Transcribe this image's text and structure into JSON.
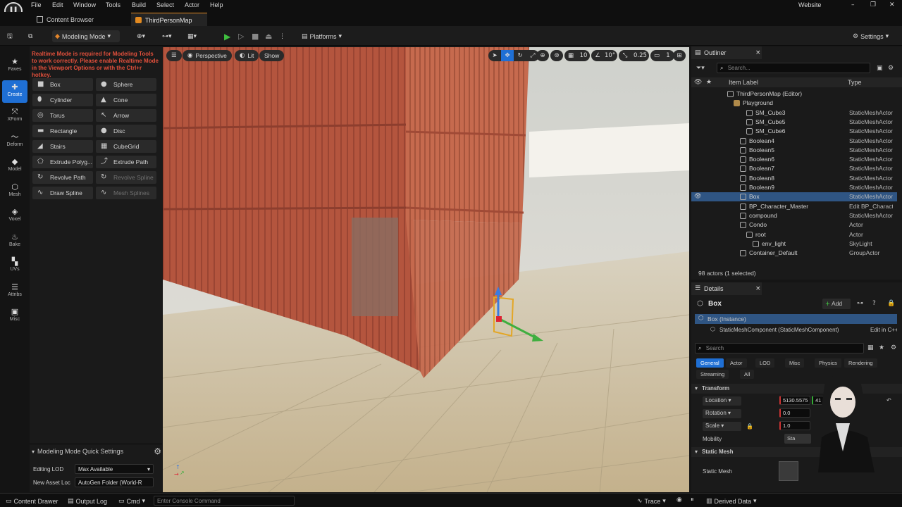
{
  "menu": {
    "items": [
      "File",
      "Edit",
      "Window",
      "Tools",
      "Build",
      "Select",
      "Actor",
      "Help"
    ],
    "right_label": "Website"
  },
  "tabs": [
    {
      "label": "Content Browser",
      "active": false
    },
    {
      "label": "ThirdPersonMap",
      "active": true
    }
  ],
  "toolbar": {
    "mode_label": "Modeling Mode",
    "platforms_label": "Platforms",
    "settings_label": "Settings"
  },
  "modes": [
    {
      "label": "Faves",
      "icon": "star-icon"
    },
    {
      "label": "Create",
      "icon": "create-icon",
      "selected": true
    },
    {
      "label": "XForm",
      "icon": "xform-icon"
    },
    {
      "label": "Deform",
      "icon": "deform-icon"
    },
    {
      "label": "Model",
      "icon": "model-icon"
    },
    {
      "label": "Mesh",
      "icon": "mesh-icon"
    },
    {
      "label": "Voxel",
      "icon": "voxel-icon"
    },
    {
      "label": "Bake",
      "icon": "bake-icon"
    },
    {
      "label": "UVs",
      "icon": "uvs-icon"
    },
    {
      "label": "Attribs",
      "icon": "attribs-icon"
    },
    {
      "label": "Misc",
      "icon": "misc-icon"
    }
  ],
  "tool_panel": {
    "warning": "Realtime Mode is required for Modeling Tools to work correctly. Please enable Realtime Mode in the Viewport Options or with the Ctrl+r hotkey.",
    "tools": [
      {
        "label": "Box",
        "icon": "box-icon"
      },
      {
        "label": "Sphere",
        "icon": "sphere-icon"
      },
      {
        "label": "Cylinder",
        "icon": "cylinder-icon"
      },
      {
        "label": "Cone",
        "icon": "cone-icon"
      },
      {
        "label": "Torus",
        "icon": "torus-icon"
      },
      {
        "label": "Arrow",
        "icon": "arrow-icon"
      },
      {
        "label": "Rectangle",
        "icon": "rectangle-icon"
      },
      {
        "label": "Disc",
        "icon": "disc-icon"
      },
      {
        "label": "Stairs",
        "icon": "stairs-icon"
      },
      {
        "label": "CubeGrid",
        "icon": "cubegrid-icon"
      },
      {
        "label": "Extrude Polyg...",
        "icon": "extrude-polygon-icon"
      },
      {
        "label": "Extrude Path",
        "icon": "extrude-path-icon"
      },
      {
        "label": "Revolve Path",
        "icon": "revolve-path-icon"
      },
      {
        "label": "Revolve Spline",
        "icon": "revolve-spline-icon",
        "disabled": true
      },
      {
        "label": "Draw Spline",
        "icon": "draw-spline-icon"
      },
      {
        "label": "Mesh Splines",
        "icon": "mesh-splines-icon",
        "disabled": true
      }
    ],
    "quick_settings_title": "Modeling Mode Quick Settings",
    "editing_lod_label": "Editing LOD",
    "editing_lod_value": "Max Available",
    "new_asset_label": "New Asset Loc",
    "new_asset_value": "AutoGen Folder (World-R"
  },
  "viewport": {
    "perspective_label": "Perspective",
    "lit_label": "Lit",
    "show_label": "Show",
    "grid_snap": "10",
    "rotation_snap": "10°",
    "scale_snap": "0.25",
    "camera_speed": "1"
  },
  "outliner": {
    "title": "Outliner",
    "search_placeholder": "Search...",
    "col_label": "Item Label",
    "col_type": "Type",
    "rows": [
      {
        "label": "ThirdPersonMap (Editor)",
        "type": "",
        "indent": 0
      },
      {
        "label": "Playground",
        "type": "",
        "indent": 1,
        "folder": true
      },
      {
        "label": "SM_Cube3",
        "type": "StaticMeshActor",
        "indent": 3
      },
      {
        "label": "SM_Cube5",
        "type": "StaticMeshActor",
        "indent": 3
      },
      {
        "label": "SM_Cube6",
        "type": "StaticMeshActor",
        "indent": 3
      },
      {
        "label": "Boolean4",
        "type": "StaticMeshActor",
        "indent": 2
      },
      {
        "label": "Boolean5",
        "type": "StaticMeshActor",
        "indent": 2
      },
      {
        "label": "Boolean6",
        "type": "StaticMeshActor",
        "indent": 2
      },
      {
        "label": "Boolean7",
        "type": "StaticMeshActor",
        "indent": 2
      },
      {
        "label": "Boolean8",
        "type": "StaticMeshActor",
        "indent": 2
      },
      {
        "label": "Boolean9",
        "type": "StaticMeshActor",
        "indent": 2
      },
      {
        "label": "Box",
        "type": "StaticMeshActor",
        "indent": 2,
        "selected": true
      },
      {
        "label": "BP_Character_Master",
        "type": "Edit BP_Charact",
        "indent": 2
      },
      {
        "label": "compound",
        "type": "StaticMeshActor",
        "indent": 2
      },
      {
        "label": "Condo",
        "type": "Actor",
        "indent": 2
      },
      {
        "label": "root",
        "type": "Actor",
        "indent": 3
      },
      {
        "label": "env_light",
        "type": "SkyLight",
        "indent": 4
      },
      {
        "label": "Container_Default",
        "type": "GroupActor",
        "indent": 2
      }
    ],
    "footer": "98 actors (1 selected)"
  },
  "details": {
    "title": "Details",
    "object_name": "Box",
    "add_label": "Add",
    "instance_label": "Box (Instance)",
    "component_label": "StaticMeshComponent (StaticMeshComponent)",
    "edit_cpp_label": "Edit in C++",
    "search_placeholder": "Search",
    "filter_tabs": [
      "General",
      "Actor",
      "LOD",
      "Misc",
      "Physics",
      "Rendering"
    ],
    "filter_tabs2": [
      "Streaming",
      "All"
    ],
    "transform_section": "Transform",
    "location_label": "Location",
    "rotation_label": "Rotation",
    "scale_label": "Scale",
    "mobility_label": "Mobility",
    "static_mesh_section": "Static Mesh",
    "static_mesh_label": "Static Mesh",
    "location_value": "5130.5575",
    "location_value_y": "41",
    "rotation_value": "0.0",
    "scale_value": "1.0",
    "mobility_value": "Sta"
  },
  "status": {
    "content_drawer": "Content Drawer",
    "output_log": "Output Log",
    "cmd_label": "Cmd",
    "console_placeholder": "Enter Console Command",
    "trace_label": "Trace",
    "derived_data_label": "Derived Data"
  },
  "colors": {
    "accent": "#1f6fd4",
    "warning": "#e2503c",
    "container": "#b4553e",
    "floor": "#cbbb96"
  }
}
